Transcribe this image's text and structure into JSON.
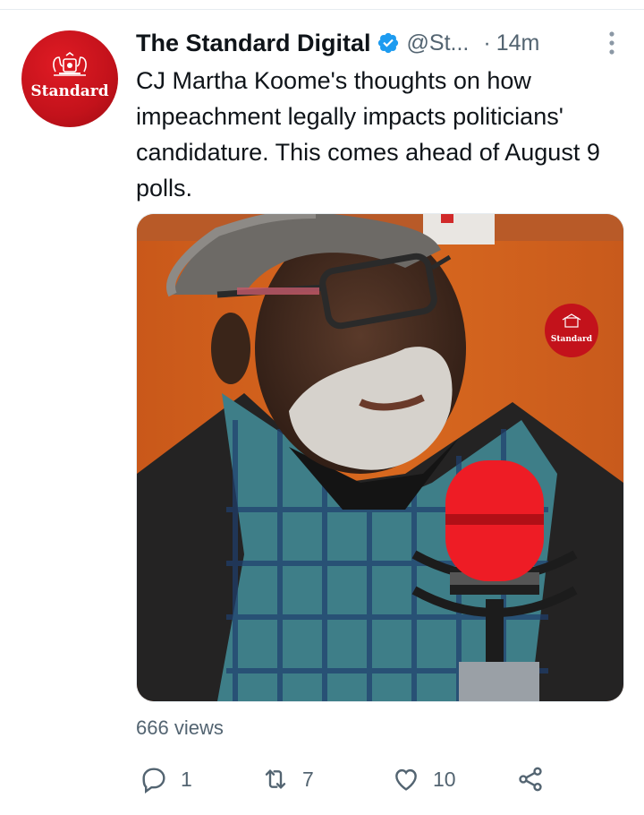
{
  "tweet": {
    "author_name": "The Standard Digital",
    "handle": "@St...",
    "separator": "·",
    "time": "14m",
    "text": "CJ Martha Koome's thoughts on how impeachment legally impacts politicians' candidature. This comes ahead of August 9 polls.",
    "views": "666 views"
  },
  "avatar": {
    "wordmark": "Standard"
  },
  "media": {
    "watermark": "Standard"
  },
  "actions": {
    "reply_count": "1",
    "retweet_count": "7",
    "like_count": "10"
  },
  "icons": {
    "verified": "verified-badge-icon",
    "more": "more-vertical-icon",
    "reply": "reply-icon",
    "retweet": "retweet-icon",
    "like": "heart-icon",
    "share": "share-icon"
  },
  "colors": {
    "brand_red": "#c3121b",
    "verified_blue": "#1d9bf0",
    "secondary_text": "#536471",
    "primary_text": "#0f1419"
  }
}
